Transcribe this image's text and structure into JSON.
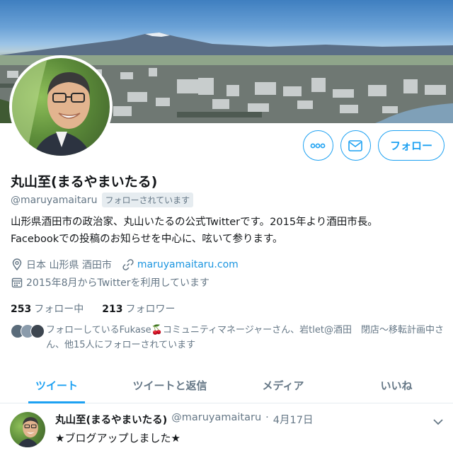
{
  "profile": {
    "name": "丸山至(まるやまいたる)",
    "handle": "@maruyamaitaru",
    "followed_badge": "フォローされています",
    "bio_line1": "山形県酒田市の政治家、丸山いたるの公式Twitterです。2015年より酒田市長。",
    "bio_line2": "Facebookでの投稿のお知らせを中心に、呟いて参ります。",
    "location": "日本 山形県 酒田市",
    "website": "maruyamaitaru.com",
    "joined": "2015年8月からTwitterを利用しています",
    "following_count": "253",
    "following_label": "フォロー中",
    "followers_count": "213",
    "followers_label": "フォロワー",
    "known_followers_text": "フォローしているFukase🍒コミュニティマネージャーさん、岩tlet@酒田　閉店～移転計画中さん、他15人にフォローされています"
  },
  "actions": {
    "more_icon": "more-dots-icon",
    "message_icon": "envelope-icon",
    "follow_label": "フォロー"
  },
  "tabs": [
    {
      "label": "ツイート",
      "active": true
    },
    {
      "label": "ツイートと返信",
      "active": false
    },
    {
      "label": "メディア",
      "active": false
    },
    {
      "label": "いいね",
      "active": false
    }
  ],
  "tweet": {
    "name": "丸山至(まるやまいたる)",
    "handle": "@maruyamaitaru",
    "separator": "·",
    "date": "4月17日",
    "text": "★ブログアップしました★"
  },
  "colors": {
    "accent": "#1da1f2",
    "muted": "#657786",
    "link": "#1b95e0"
  }
}
